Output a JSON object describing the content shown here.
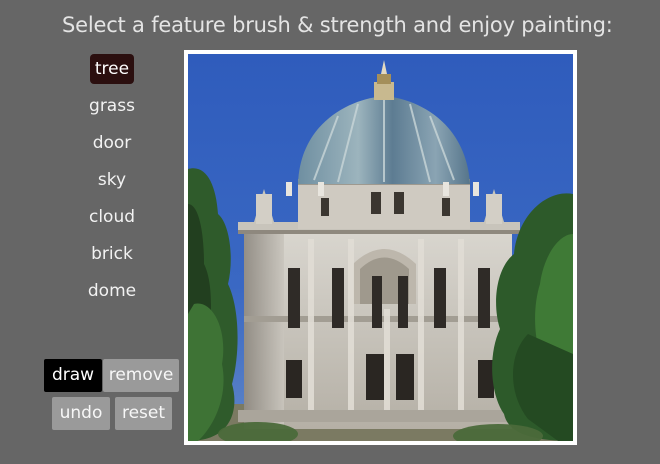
{
  "header": {
    "instruction": "Select a feature brush & strength and enjoy painting:"
  },
  "features": [
    {
      "label": "tree",
      "selected": true
    },
    {
      "label": "grass",
      "selected": false
    },
    {
      "label": "door",
      "selected": false
    },
    {
      "label": "sky",
      "selected": false
    },
    {
      "label": "cloud",
      "selected": false
    },
    {
      "label": "brick",
      "selected": false
    },
    {
      "label": "dome",
      "selected": false
    }
  ],
  "controls": {
    "draw_label": "draw",
    "remove_label": "remove",
    "undo_label": "undo",
    "reset_label": "reset"
  },
  "colors": {
    "background": "#666666",
    "selected_feature": "#2b0f0f",
    "active_button": "#000000",
    "inactive_button": "#9a9a9a",
    "sky": "#2e57b4"
  }
}
